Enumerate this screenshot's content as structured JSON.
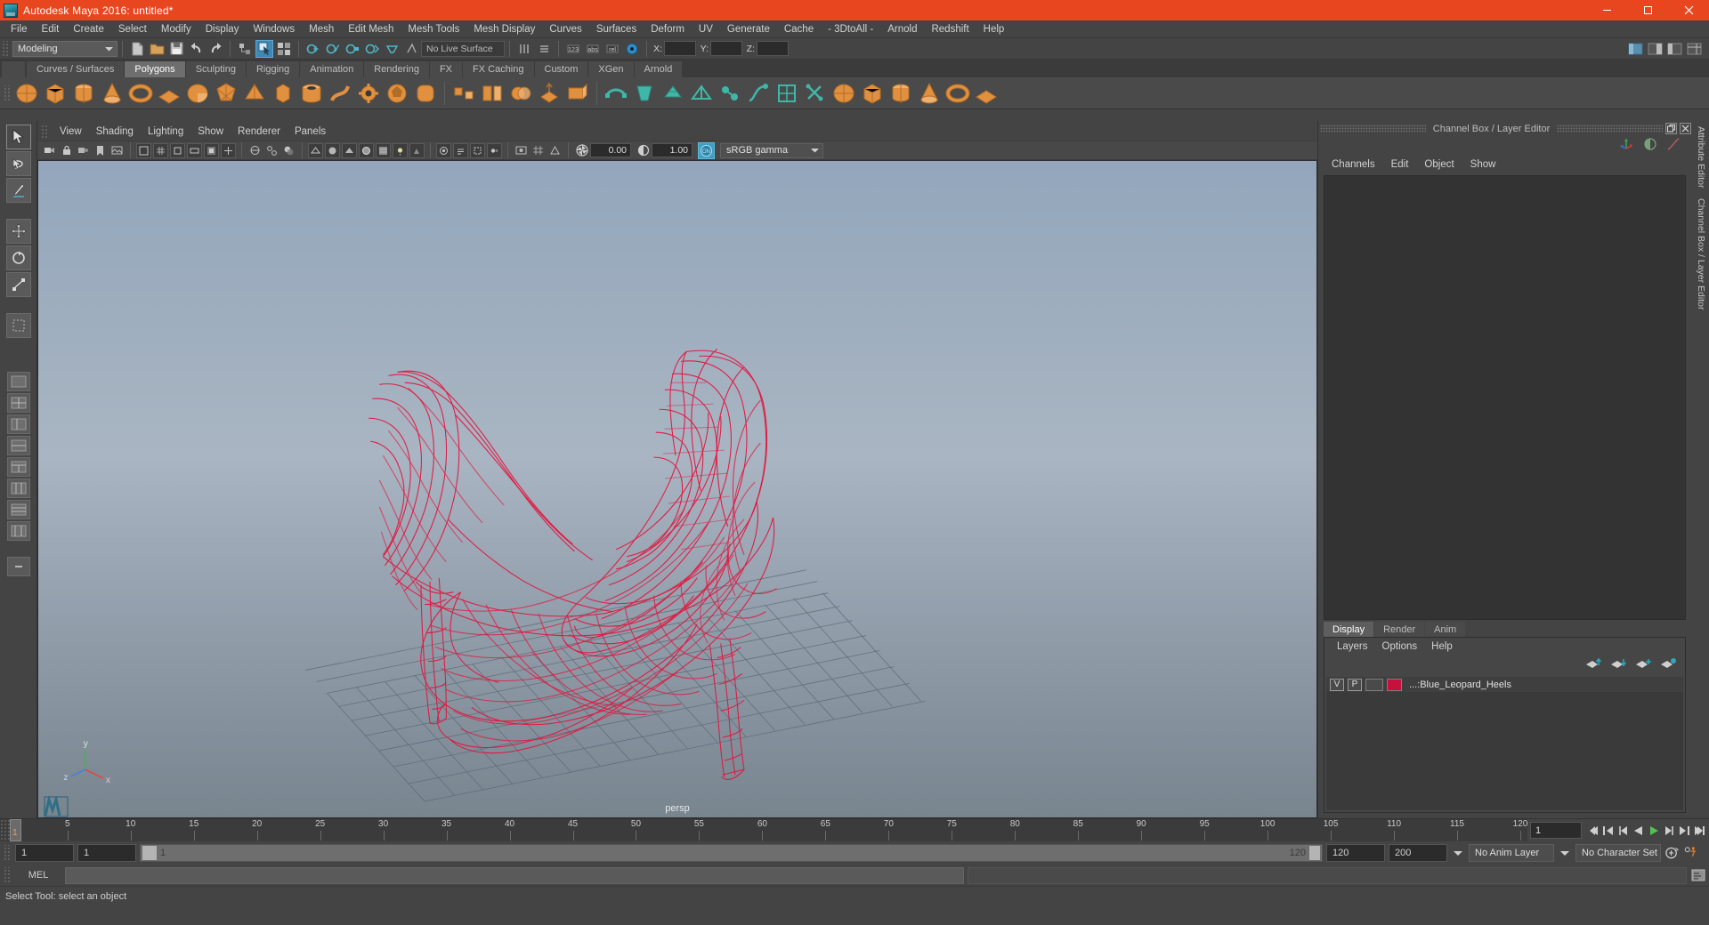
{
  "window": {
    "title": "Autodesk Maya 2016: untitled*",
    "logo_icon": "maya-logo-icon",
    "minimize": "–",
    "maximize": "❐",
    "close": "✕"
  },
  "menubar": {
    "items": [
      "File",
      "Edit",
      "Create",
      "Select",
      "Modify",
      "Display",
      "Windows",
      "Mesh",
      "Edit Mesh",
      "Mesh Tools",
      "Mesh Display",
      "Curves",
      "Surfaces",
      "Deform",
      "UV",
      "Generate",
      "Cache",
      "- 3DtoAll -",
      "Arnold",
      "Redshift",
      "Help"
    ]
  },
  "statusbar": {
    "mode": "Modeling",
    "mode_arrow_icon": "chevron-down-icon",
    "live_surface": "No Live Surface",
    "coords": {
      "x_label": "X:",
      "y_label": "Y:",
      "z_label": "Z:",
      "x": "",
      "y": "",
      "z": ""
    },
    "icons": [
      "new-scene-icon",
      "open-scene-icon",
      "save-scene-icon",
      "undo-icon",
      "redo-icon",
      "select-hierarchy-icon",
      "select-object-icon",
      "select-component-icon",
      "snap-grid-icon",
      "snap-curve-icon",
      "snap-point-icon",
      "snap-projected-icon",
      "snap-view-plane-icon",
      "make-live-icon",
      "render-current-frame-icon",
      "ipr-render-icon",
      "render-settings-icon",
      "show-hide-editors-icon",
      "attribute-editor-toggle-icon",
      "tool-settings-toggle-icon",
      "channel-box-toggle-icon"
    ]
  },
  "shelf": {
    "tabs": [
      "Curves / Surfaces",
      "Polygons",
      "Sculpting",
      "Rigging",
      "Animation",
      "Rendering",
      "FX",
      "FX Caching",
      "Custom",
      "XGen",
      "Arnold"
    ],
    "active_tab": "Polygons",
    "buttons": [
      "poly-sphere-icon",
      "poly-cube-icon",
      "poly-cylinder-icon",
      "poly-cone-icon",
      "poly-torus-icon",
      "poly-plane-icon",
      "poly-disc-icon",
      "poly-platonic-icon",
      "poly-pyramid-icon",
      "poly-prism-icon",
      "poly-pipe-icon",
      "poly-helix-icon",
      "poly-gear-icon",
      "poly-soccer-ball-icon",
      "poly-super-ellipse-icon",
      "combine-icon",
      "separate-icon",
      "booleans-icon",
      "extrude-icon",
      "bevel-icon",
      "bridge-icon",
      "append-polygon-icon",
      "wedge-icon",
      "smooth-icon",
      "triangulate-icon",
      "quadrangulate-icon",
      "mirror-icon",
      "reduce-icon",
      "multi-cut-icon",
      "target-weld-icon",
      "crease-icon",
      "sculpt-icon",
      "paint-select-icon",
      "uv-editor-icon"
    ]
  },
  "toolbox": {
    "tools": [
      "select-tool-icon",
      "lasso-select-tool-icon",
      "paint-select-tool-icon",
      "move-tool-icon",
      "rotate-tool-icon",
      "scale-tool-icon",
      "last-tool-used-icon",
      "show-manipulator-tool-icon"
    ],
    "layout_buttons": [
      "single-perspective-view-icon",
      "four-view-icon",
      "outliner-persp-view-icon",
      "persp-graph-view-icon",
      "hypershade-persp-view-icon",
      "persp-uv-view-icon",
      "two-panes-stacked-icon",
      "two-panes-side-icon",
      "more-layouts-icon"
    ]
  },
  "viewport": {
    "menus": [
      "View",
      "Shading",
      "Lighting",
      "Show",
      "Renderer",
      "Panels"
    ],
    "exposure": "0.00",
    "gamma": "1.00",
    "color_management": "sRGB gamma",
    "color_management_arrow_icon": "chevron-down-icon",
    "camera_label": "persp",
    "axis_labels": {
      "x": "x",
      "y": "y",
      "z": "z"
    },
    "toolbar_icons": [
      "select-camera-icon",
      "lock-camera-icon",
      "camera-attributes-icon",
      "bookmarks-icon",
      "image-plane-icon",
      "two-d-pan-zoom-icon",
      "grid-toggle-icon",
      "film-gate-icon",
      "resolution-gate-icon",
      "gate-mask-icon",
      "film-origin-icon",
      "xray-toggle-icon",
      "xray-joints-icon",
      "shadows-toggle-icon",
      "screen-space-ao-icon",
      "motion-blur-icon",
      "multisample-icon",
      "depth-of-field-icon",
      "wireframe-shading-icon",
      "smooth-shade-all-icon",
      "flat-shade-icon",
      "shaded-wireframe-icon",
      "textured-icon",
      "use-all-lights-icon",
      "shadow-map-icon",
      "viewport-renderer-icon",
      "isolate-select-icon",
      "grid-display-icon",
      "exposure-icon",
      "contrast-icon",
      "color-management-icon"
    ],
    "scene_object": "Blue_Leopard_Heels wireframe",
    "wireframe_color": "#e4153f",
    "background_top": "#93a6bb",
    "background_bottom": "#7b8896"
  },
  "channel_box": {
    "title": "Channel Box / Layer Editor",
    "undock_icon": "undock-icon",
    "close_icon": "close-icon",
    "header_icons": [
      "move-manipulator-icon",
      "shading-toggle-icon",
      "anim-curve-icon"
    ],
    "menus": [
      "Channels",
      "Edit",
      "Object",
      "Show"
    ]
  },
  "side_tabs": [
    "Attribute Editor",
    "Channel Box / Layer Editor"
  ],
  "layer_editor": {
    "tabs": [
      "Display",
      "Render",
      "Anim"
    ],
    "active_tab": "Display",
    "menus": [
      "Layers",
      "Options",
      "Help"
    ],
    "buttons": [
      "move-layer-up-icon",
      "move-layer-down-icon",
      "new-layer-icon",
      "new-layer-from-selected-icon"
    ],
    "layers": [
      {
        "visibility": "V",
        "playback": "P",
        "shading": "",
        "color": "#c8103c",
        "name": "...:Blue_Leopard_Heels"
      }
    ]
  },
  "timeline": {
    "current_frame": "1",
    "ticks": [
      5,
      10,
      15,
      20,
      25,
      30,
      35,
      40,
      45,
      50,
      55,
      60,
      65,
      70,
      75,
      80,
      85,
      90,
      95,
      100,
      105,
      110,
      115,
      120
    ],
    "range_start": 1,
    "range_end": 120,
    "field_value": "1",
    "playback_icons": [
      "go-to-start-icon",
      "step-back-keyframe-icon",
      "step-back-frame-icon",
      "play-backwards-icon",
      "play-forwards-icon",
      "step-forward-frame-icon",
      "step-forward-keyframe-icon",
      "go-to-end-icon"
    ]
  },
  "range_slider": {
    "anim_start": "1",
    "range_start": "1",
    "slider_start": "1",
    "slider_end": "120",
    "range_end": "120",
    "anim_end": "200",
    "anim_layer": "No Anim Layer",
    "character_set": "No Character Set",
    "anim_layer_arrow_icon": "chevron-down-icon",
    "character_set_arrow_icon": "chevron-down-icon",
    "auto_keyframe_icon": "auto-keyframe-icon",
    "animation_preferences_icon": "animation-preferences-icon"
  },
  "command_line": {
    "label": "MEL",
    "input_value": "",
    "output_value": "",
    "script_editor_icon": "script-editor-icon"
  },
  "status_message": "Select Tool: select an object"
}
